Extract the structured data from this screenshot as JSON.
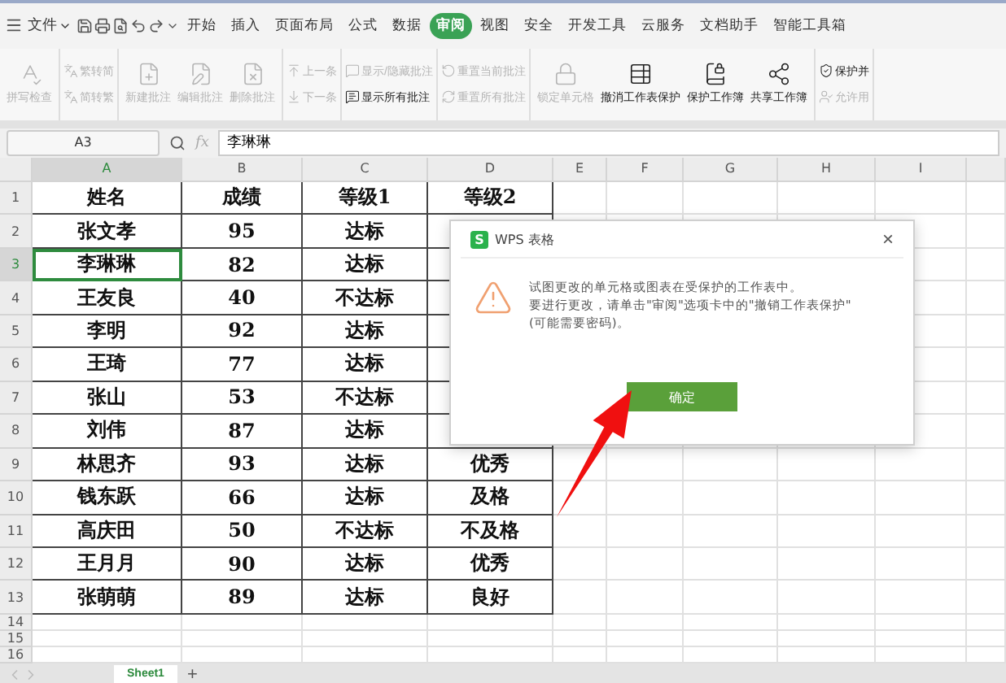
{
  "menu": {
    "file": "文件",
    "tabs": [
      {
        "label": "开始",
        "selected": false
      },
      {
        "label": "插入",
        "selected": false
      },
      {
        "label": "页面布局",
        "selected": false
      },
      {
        "label": "公式",
        "selected": false
      },
      {
        "label": "数据",
        "selected": false
      },
      {
        "label": "审阅",
        "selected": true
      },
      {
        "label": "视图",
        "selected": false
      },
      {
        "label": "安全",
        "selected": false
      },
      {
        "label": "开发工具",
        "selected": false
      },
      {
        "label": "云服务",
        "selected": false
      },
      {
        "label": "文档助手",
        "selected": false
      },
      {
        "label": "智能工具箱",
        "selected": false
      }
    ]
  },
  "ribbon": [
    {
      "kind": "large",
      "items": [
        {
          "label": "拼写检查",
          "disabled": true
        }
      ]
    },
    {
      "kind": "small",
      "items": [
        {
          "label": "繁转简",
          "disabled": true
        },
        {
          "label": "简转繁",
          "disabled": true
        }
      ]
    },
    {
      "kind": "large",
      "items": [
        {
          "label": "新建批注",
          "disabled": true
        },
        {
          "label": "编辑批注",
          "disabled": true
        },
        {
          "label": "删除批注",
          "disabled": true
        }
      ]
    },
    {
      "kind": "small",
      "items": [
        {
          "label": "上一条",
          "disabled": true
        },
        {
          "label": "下一条",
          "disabled": true
        }
      ]
    },
    {
      "kind": "small",
      "items": [
        {
          "label": "显示/隐藏批注",
          "disabled": true
        },
        {
          "label": "显示所有批注",
          "disabled": false
        }
      ]
    },
    {
      "kind": "small",
      "items": [
        {
          "label": "重置当前批注",
          "disabled": true
        },
        {
          "label": "重置所有批注",
          "disabled": true
        }
      ]
    },
    {
      "kind": "large",
      "items": [
        {
          "label": "锁定单元格",
          "disabled": true
        },
        {
          "label": "撤消工作表保护",
          "disabled": false
        },
        {
          "label": "保护工作簿",
          "disabled": false
        },
        {
          "label": "共享工作簿",
          "disabled": false
        }
      ]
    },
    {
      "kind": "small",
      "items": [
        {
          "label": "保护并",
          "disabled": false
        },
        {
          "label": "允许用",
          "disabled": true
        }
      ]
    }
  ],
  "formula_bar": {
    "cell": "A3",
    "fx": "fx",
    "value": "李琳琳"
  },
  "columns": [
    "A",
    "B",
    "C",
    "D",
    "E",
    "F",
    "G",
    "H",
    "I"
  ],
  "rows": [
    {
      "num": "1",
      "cells": [
        "姓名",
        "成绩",
        "等级1",
        "等级2"
      ]
    },
    {
      "num": "2",
      "cells": [
        "张文孝",
        "95",
        "达标"
      ]
    },
    {
      "num": "3",
      "cells": [
        "李琳琳",
        "82",
        "达标"
      ],
      "selected": true
    },
    {
      "num": "4",
      "cells": [
        "王友良",
        "40",
        "不达标"
      ]
    },
    {
      "num": "5",
      "cells": [
        "李明",
        "92",
        "达标"
      ]
    },
    {
      "num": "6",
      "cells": [
        "王琦",
        "77",
        "达标"
      ]
    },
    {
      "num": "7",
      "cells": [
        "张山",
        "53",
        "不达标"
      ]
    },
    {
      "num": "8",
      "cells": [
        "刘伟",
        "87",
        "达标"
      ]
    },
    {
      "num": "9",
      "cells": [
        "林思齐",
        "93",
        "达标",
        "优秀"
      ]
    },
    {
      "num": "10",
      "cells": [
        "钱东跃",
        "66",
        "达标",
        "及格"
      ]
    },
    {
      "num": "11",
      "cells": [
        "高庆田",
        "50",
        "不达标",
        "不及格"
      ]
    },
    {
      "num": "12",
      "cells": [
        "王月月",
        "90",
        "达标",
        "优秀"
      ]
    },
    {
      "num": "13",
      "cells": [
        "张萌萌",
        "89",
        "达标",
        "良好"
      ]
    },
    {
      "num": "14",
      "cells": []
    },
    {
      "num": "15",
      "cells": []
    },
    {
      "num": "16",
      "cells": []
    }
  ],
  "sheet_tabs": [
    {
      "label": "Sheet1",
      "selected": true
    }
  ],
  "add_sheet": "+",
  "dialog": {
    "title": "WPS 表格",
    "logo": "S",
    "close": "×",
    "message": [
      "试图更改的单元格或图表在受保护的工作表中。",
      "要进行更改，请单击\"审阅\"选项卡中的\"撤销工作表保护\"(可能需要密码)。"
    ],
    "button": "确定"
  }
}
